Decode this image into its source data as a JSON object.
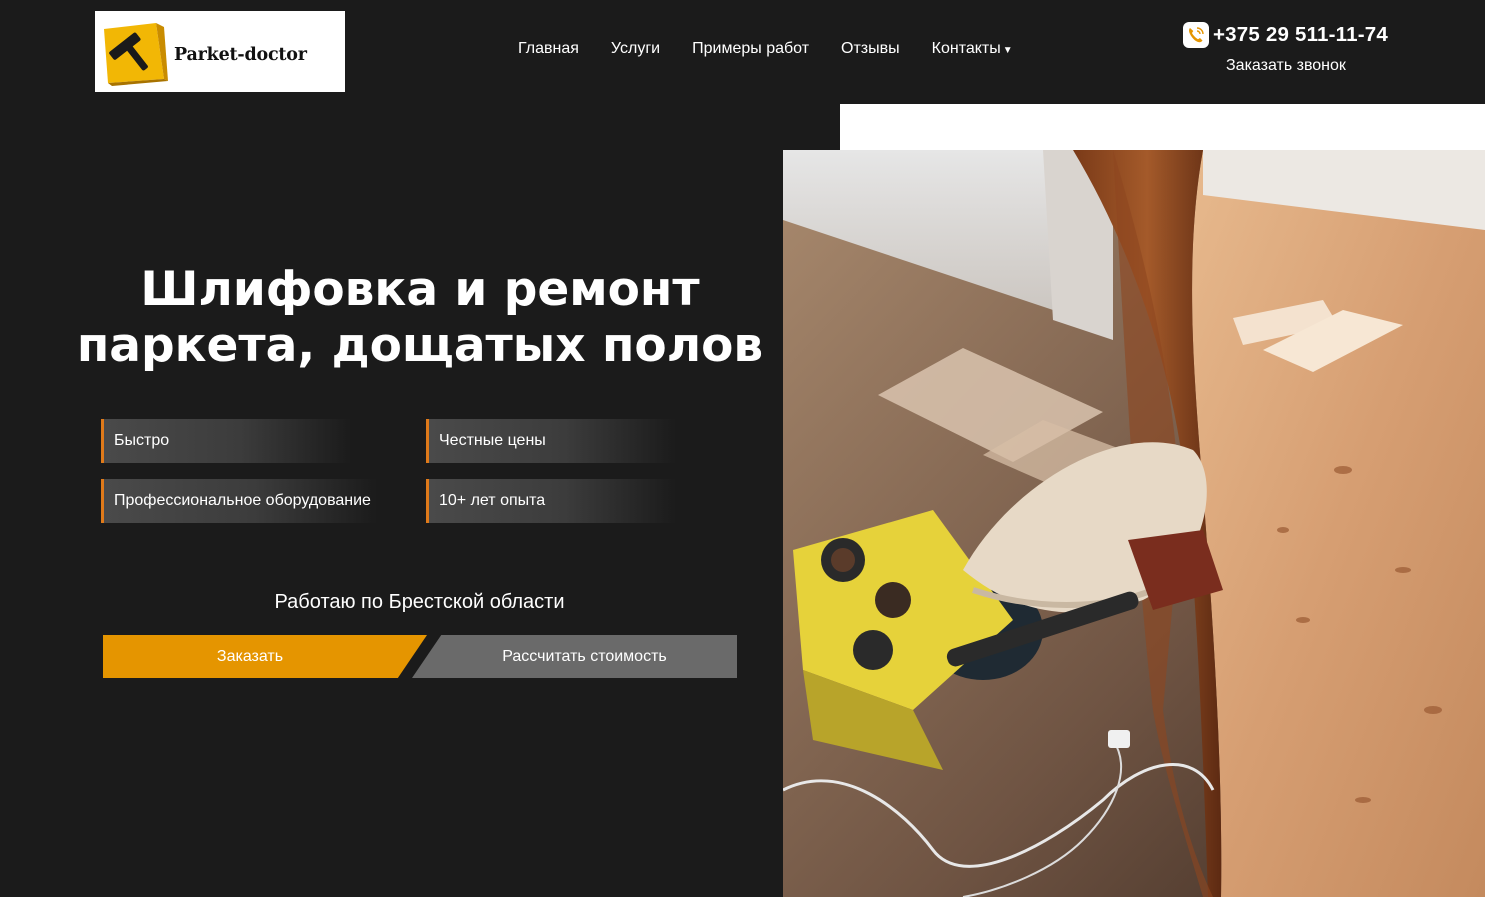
{
  "header": {
    "logo_text": "Parket-doctor",
    "logo_icon": "hammer-icon",
    "nav": [
      {
        "label": "Главная"
      },
      {
        "label": "Услуги"
      },
      {
        "label": "Примеры работ"
      },
      {
        "label": "Отзывы"
      },
      {
        "label": "Контакты",
        "dropdown_icon": "caret-down-icon"
      }
    ],
    "phone": "+375 29 511-11-74",
    "phone_icon": "phone-icon",
    "callback_label": "Заказать звонок"
  },
  "hero": {
    "title_line1": "Шлифовка и ремонт",
    "title_line2": "паркета, дощатых полов",
    "features": [
      {
        "label": "Быстро"
      },
      {
        "label": "Честные цены"
      },
      {
        "label": "Профессиональное оборудование"
      },
      {
        "label": "10+ лет опыта"
      }
    ],
    "region_text": "Работаю по Брестской области",
    "order_button": "Заказать",
    "calc_button": "Рассчитать стоимость"
  },
  "colors": {
    "background": "#1b1b1b",
    "accent_orange": "#e59500",
    "badge_border": "#e07a1a",
    "secondary_button": "#6a6a6a"
  }
}
